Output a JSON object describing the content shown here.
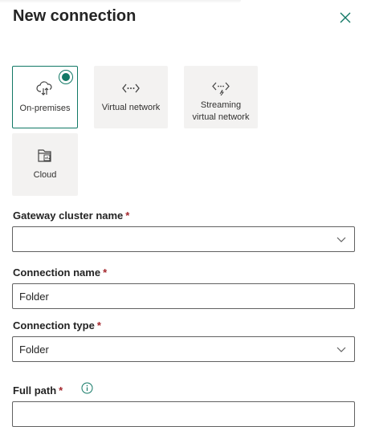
{
  "dialog": {
    "title": "New connection"
  },
  "connection_types": [
    {
      "label_line1": "On-premises",
      "label_line2": "",
      "icon": "cloud-gateway-icon",
      "selected": true
    },
    {
      "label_line1": "Virtual network",
      "label_line2": "",
      "icon": "virtual-network-icon",
      "selected": false
    },
    {
      "label_line1": "Streaming",
      "label_line2": "virtual network",
      "icon": "streaming-network-icon",
      "selected": false
    },
    {
      "label_line1": "Cloud",
      "label_line2": "",
      "icon": "cloud-folder-icon",
      "selected": false
    }
  ],
  "form": {
    "gateway_cluster": {
      "label": "Gateway cluster name",
      "required_mark": "*",
      "value": ""
    },
    "connection_name": {
      "label": "Connection name",
      "required_mark": "*",
      "value": "Folder"
    },
    "connection_type": {
      "label": "Connection type",
      "required_mark": "*",
      "value": "Folder"
    },
    "full_path": {
      "label": "Full path",
      "required_mark": "*",
      "value": ""
    }
  },
  "colors": {
    "accent": "#117865",
    "required": "#a4262c",
    "tile_bg": "#f3f2f1"
  }
}
